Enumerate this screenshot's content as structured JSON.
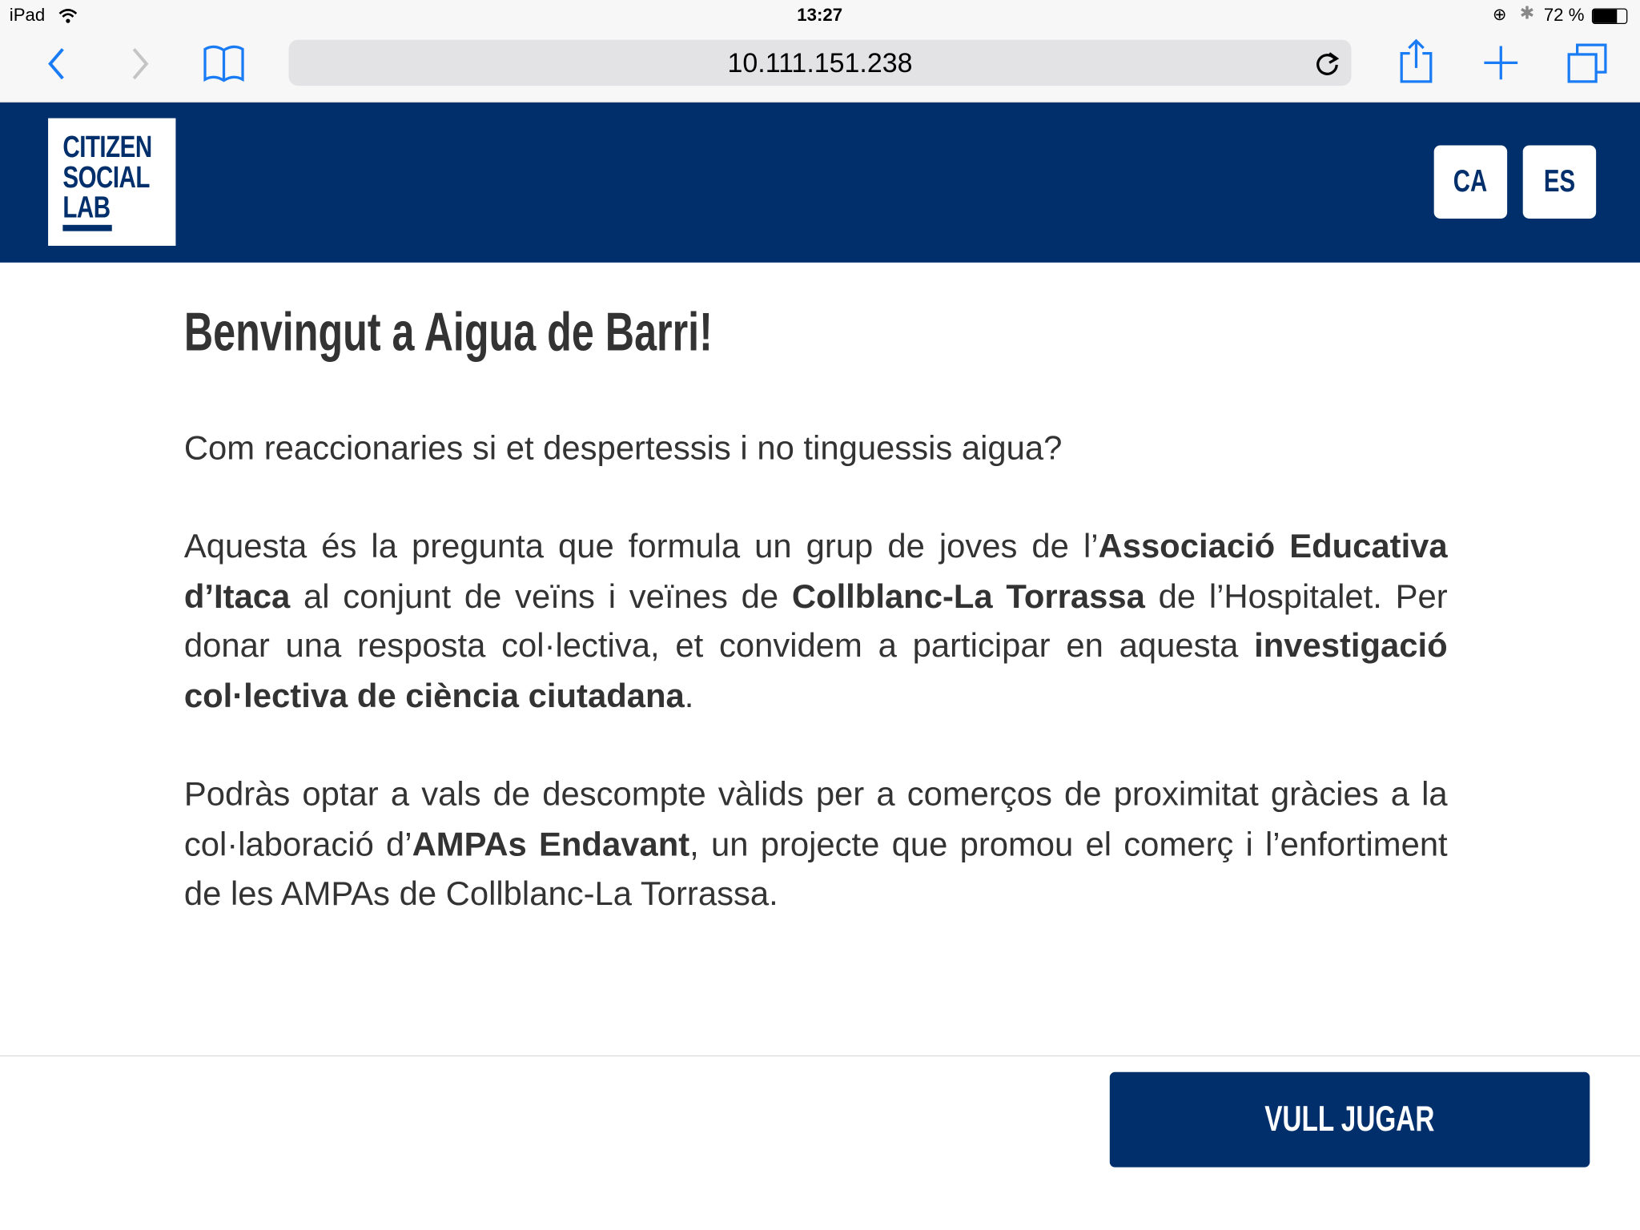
{
  "status_bar": {
    "device": "iPad",
    "time": "13:27",
    "battery": "72 %"
  },
  "browser": {
    "url": "10.111.151.238"
  },
  "header": {
    "logo": [
      "CITIZEN",
      "SOCIAL",
      "LAB"
    ],
    "languages": [
      "CA",
      "ES"
    ],
    "brand_color": "#002f6c"
  },
  "main": {
    "title": "Benvingut a Aigua de Barri!",
    "question": "Com reaccionaries si et despertessis i no tinguessis aigua?",
    "p2": {
      "t1": "Aquesta és la pregunta que formula un grup de joves de l’",
      "b1": "Associació Educativa d’Itaca",
      "t2": " al conjunt de veïns i veïnes de ",
      "b2": "Collblanc-La Torrassa",
      "t3": " de l’Hospitalet. Per donar una resposta col·lectiva, et convidem a participar en aquesta ",
      "b3": "investigació col·lectiva de ciència ciutadana",
      "t4": "."
    },
    "p3": {
      "t1": "Podràs optar a vals de descompte vàlids per a comerços de proximitat gràcies a la col·laboració d’",
      "b1": "AMPAs Endavant",
      "t2": ", un projecte que promou el comerç i l’enfortiment de les AMPAs de Collblanc-La Torrassa."
    }
  },
  "footer": {
    "play_button": "VULL JUGAR"
  }
}
